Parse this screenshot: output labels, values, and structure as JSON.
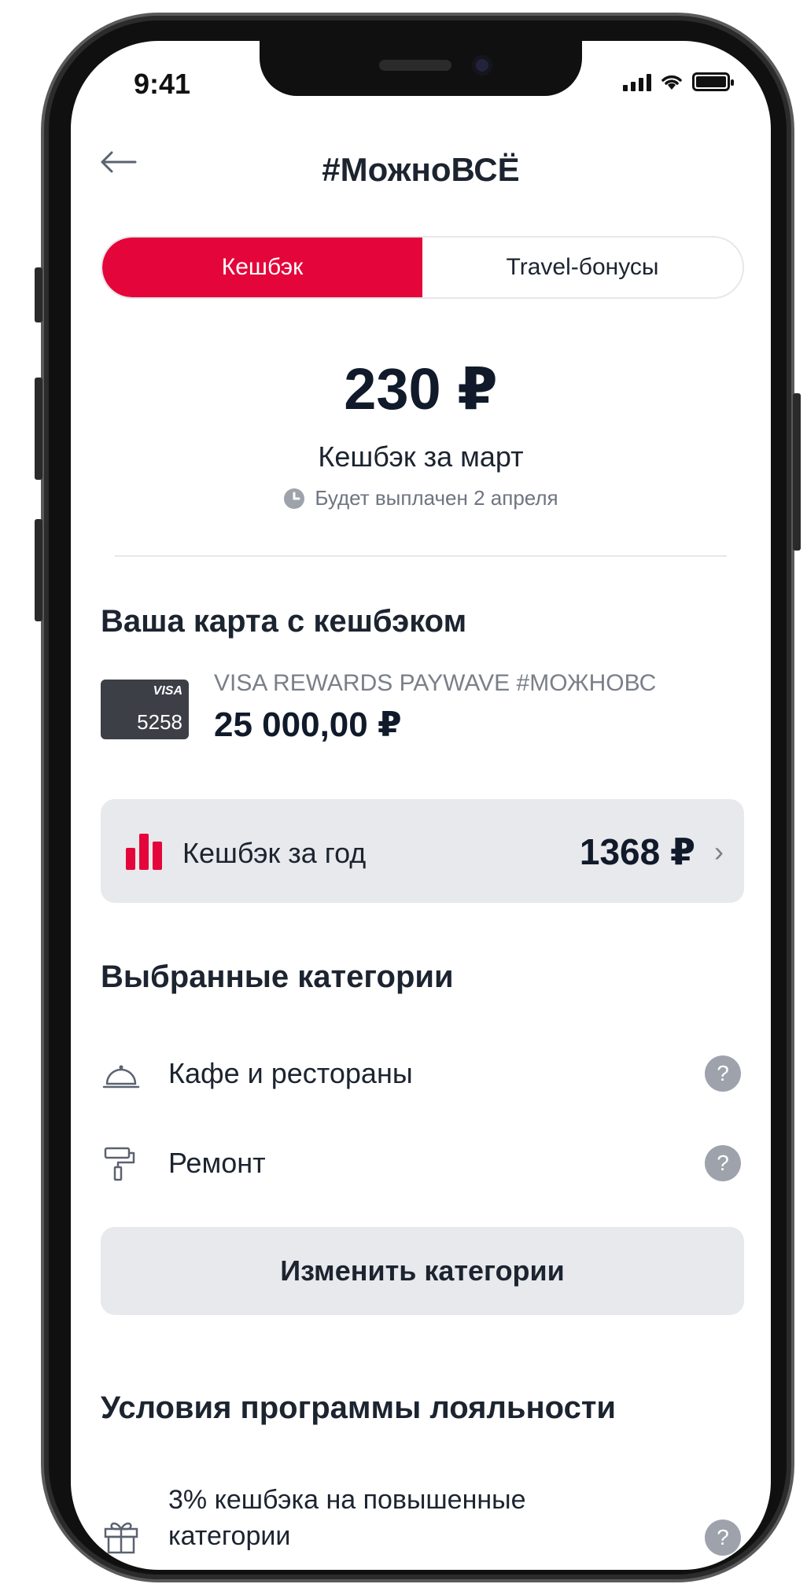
{
  "status_bar": {
    "time": "9:41"
  },
  "nav": {
    "title": "#МожноВСЁ"
  },
  "tabs": [
    {
      "label": "Кешбэк",
      "active": true
    },
    {
      "label": "Travel-бонусы",
      "active": false
    }
  ],
  "summary": {
    "amount": "230 ₽",
    "subtitle": "Кешбэк за март",
    "payout_note": "Будет выплачен 2 апреля"
  },
  "card_section": {
    "title": "Ваша карта с кешбэком",
    "card_brand": "VISA",
    "card_last_digits": "5258",
    "card_name": "VISA REWARDS PAYWAVE #МОЖНОВС",
    "balance": "25 000,00 ₽"
  },
  "year_cashback": {
    "label": "Кешбэк за год",
    "value": "1368 ₽"
  },
  "categories": {
    "title": "Выбранные категории",
    "items": [
      {
        "label": "Кафе и рестораны",
        "icon": "cloche-icon"
      },
      {
        "label": "Ремонт",
        "icon": "paint-roller-icon"
      }
    ],
    "change_button": "Изменить категории"
  },
  "conditions": {
    "title": "Условия программы лояльности",
    "items": [
      {
        "label": "3% кешбэка на повышенные категории",
        "icon": "gift-icon"
      }
    ]
  },
  "colors": {
    "accent": "#e4063a",
    "surface": "#e8e9ec",
    "text": "#1c2430",
    "muted": "#7a7f88"
  }
}
